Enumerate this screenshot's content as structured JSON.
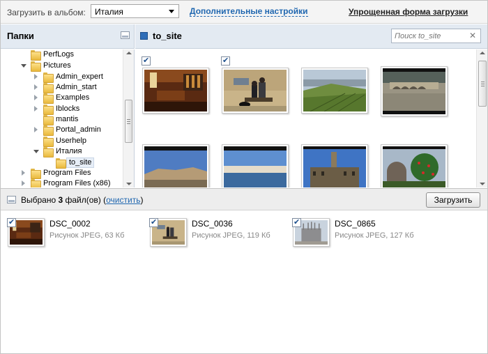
{
  "topbar": {
    "album_label": "Загрузить в альбом:",
    "album_value": "Италия",
    "advanced_link": "Дополнительные настройки",
    "simple_link": "Упрощенная форма загрузки"
  },
  "folders": {
    "title": "Папки",
    "items": [
      {
        "label": "PerfLogs",
        "state": "none",
        "selected": false
      },
      {
        "label": "Pictures",
        "state": "open",
        "selected": false
      },
      {
        "label": "Admin_expert",
        "state": "closed",
        "selected": false
      },
      {
        "label": "Admin_start",
        "state": "closed",
        "selected": false
      },
      {
        "label": "Examples",
        "state": "closed",
        "selected": false
      },
      {
        "label": "Iblocks",
        "state": "closed",
        "selected": false
      },
      {
        "label": "mantis",
        "state": "none",
        "selected": false
      },
      {
        "label": "Portal_admin",
        "state": "closed",
        "selected": false
      },
      {
        "label": "Userhelp",
        "state": "none",
        "selected": false
      },
      {
        "label": "Италия",
        "state": "open",
        "selected": false
      },
      {
        "label": "to_site",
        "state": "none",
        "selected": true
      },
      {
        "label": "Program Files",
        "state": "closed",
        "selected": false
      },
      {
        "label": "Program Files (x86)",
        "state": "closed",
        "selected": false
      }
    ]
  },
  "main": {
    "title": "to_site",
    "search_placeholder": "Поиск to_site",
    "clear_symbol": "✕",
    "photos": [
      {
        "checked": true,
        "scene": "wine-cellar"
      },
      {
        "checked": true,
        "scene": "people-bench"
      },
      {
        "checked": false,
        "scene": "vineyard"
      },
      {
        "checked": false,
        "scene": "river-bridge"
      },
      {
        "checked": false,
        "scene": "hill-town"
      },
      {
        "checked": false,
        "scene": "seaside-town"
      },
      {
        "checked": false,
        "scene": "palazzo-tower"
      },
      {
        "checked": false,
        "scene": "castle-flowers"
      }
    ]
  },
  "selection": {
    "prefix": "Выбрано ",
    "count": "3",
    "suffix": " файл(ов) (",
    "clear_link": "очистить",
    "close_paren": ")",
    "upload_button": "Загрузить",
    "items": [
      {
        "name": "DSC_0002",
        "meta": "Рисунок JPEG, 63 Кб",
        "scene": "wine-cellar"
      },
      {
        "name": "DSC_0036",
        "meta": "Рисунок JPEG, 119 Кб",
        "scene": "people-bench"
      },
      {
        "name": "DSC_0865",
        "meta": "Рисунок JPEG, 127 Кб",
        "scene": "cathedral"
      }
    ]
  }
}
